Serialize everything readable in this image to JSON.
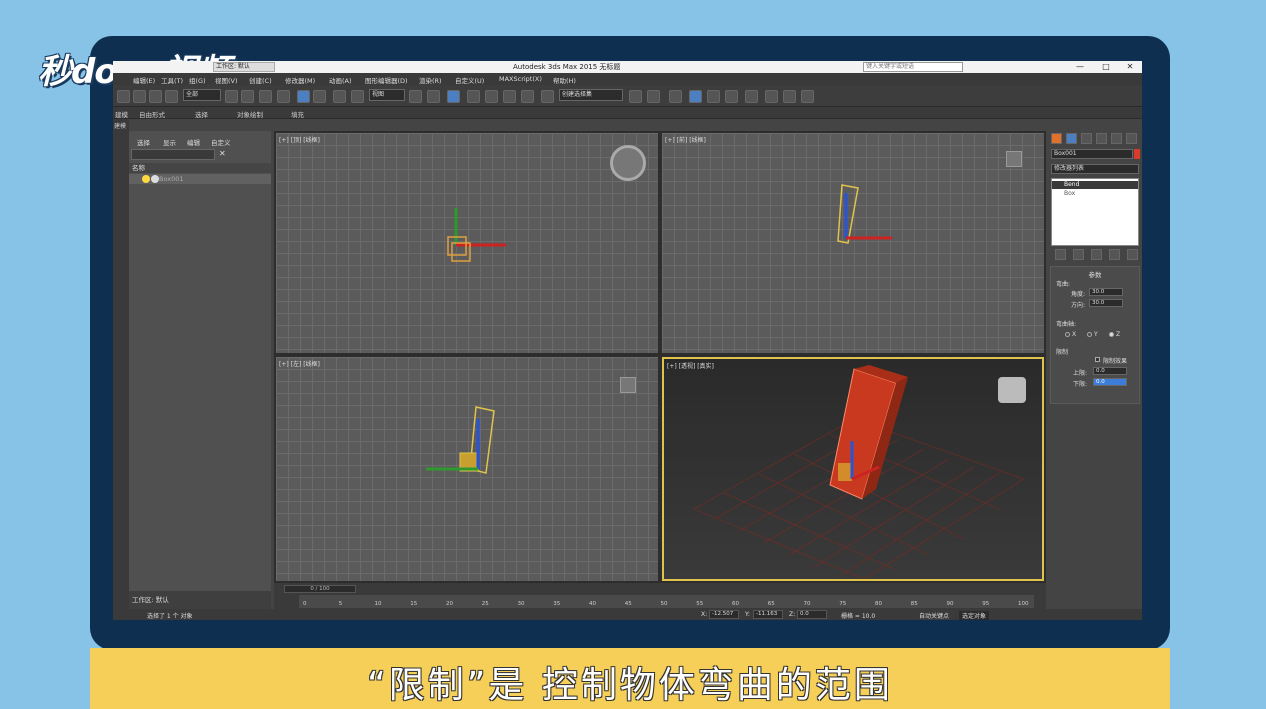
{
  "logo": "秒dong视频",
  "subtitle": "“限制”是 控制物体弯曲的范围",
  "window": {
    "workspace_label": "工作区: 默认",
    "title": "Autodesk 3ds Max  2015     无标题",
    "search_placeholder": "键入关键字或短语",
    "min": "—",
    "max": "□",
    "close": "✕"
  },
  "menu": [
    "编辑(E)",
    "工具(T)",
    "组(G)",
    "视图(V)",
    "创建(C)",
    "修改器(M)",
    "动画(A)",
    "图形编辑器(D)",
    "渲染(R)",
    "自定义(U)",
    "MAXScript(X)",
    "帮助(H)"
  ],
  "toolbar": {
    "filter_value": "全部",
    "view_value": "视图",
    "selection_set_value": "创建选择集"
  },
  "ribbon": [
    "建模",
    "自由形式",
    "选择",
    "对象绘制",
    "填充"
  ],
  "left_strip_label": "建模",
  "explorer": {
    "tabs": [
      "选择",
      "显示",
      "编辑",
      "自定义"
    ],
    "column_header": "名称",
    "row_label": "Box001",
    "footer": "工作区: 默认"
  },
  "viewports": {
    "top": "[+] [顶] [线框]",
    "front": "[+] [前] [线框]",
    "left": "[+] [左] [线框]",
    "perspective": "[+] [透视] [真实]"
  },
  "timeline": {
    "slider": "0 / 100",
    "ticks": [
      "0",
      "5",
      "10",
      "15",
      "20",
      "25",
      "30",
      "35",
      "40",
      "45",
      "50",
      "55",
      "60",
      "65",
      "70",
      "75",
      "80",
      "85",
      "90",
      "95",
      "100"
    ]
  },
  "command_panel": {
    "object_name": "Box001",
    "modifier_list": "修改器列表",
    "stack": [
      "Bend",
      "Box"
    ],
    "params_title": "参数",
    "bend_label": "弯曲:",
    "angle_label": "角度:",
    "angle_value": "30.0",
    "direction_label": "方向:",
    "direction_value": "30.0",
    "axis_label": "弯曲轴:",
    "axes": [
      "X",
      "Y",
      "Z"
    ],
    "axis_selected": "Z",
    "limits_label": "限制",
    "limit_effect_label": "限制效果",
    "upper_label": "上限:",
    "upper_value": "0.0",
    "lower_label": "下限:",
    "lower_value": "0.0"
  },
  "status": {
    "message": "选择了 1 个 对象",
    "x_label": "X:",
    "x_value": "-12.507",
    "y_label": "Y:",
    "y_value": "-11.163",
    "z_label": "Z:",
    "z_value": "0.0",
    "grid": "栅格 = 10.0",
    "autokey": "自动关键点",
    "selected_objects": "选定对象"
  },
  "colors": {
    "frame": "#0f2f50",
    "background": "#86c3e6",
    "subtitle_bar": "#f5cf57",
    "object_red": "#c9391f",
    "selection_yellow": "#e0c34c"
  }
}
